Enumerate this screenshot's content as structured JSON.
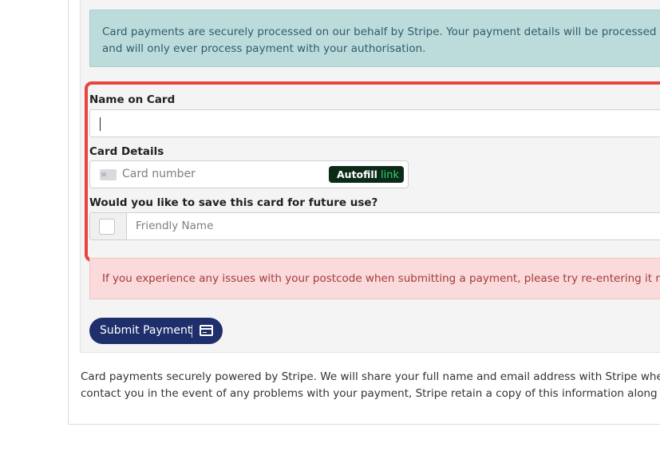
{
  "info_alert": {
    "line1": "Card payments are securely processed on our behalf by Stripe. Your payment details will be processed and stored",
    "line2": "and will only ever process payment with your authorisation."
  },
  "form": {
    "name_label": "Name on Card",
    "name_value": "",
    "card_label": "Card Details",
    "card_placeholder": "Card number",
    "autofill_text": "Autofill",
    "autofill_link_text": "link",
    "save_label": "Would you like to save this card for future use?",
    "friendly_placeholder": "Friendly Name"
  },
  "warning_alert": {
    "text": "If you experience any issues with your postcode when submitting a payment, please try re-entering it manually ar"
  },
  "submit": {
    "label": "Submit Payment"
  },
  "footer": {
    "line1": "Card payments securely powered by Stripe. We will share your full name and email address with Stripe when making p",
    "line2": "contact you in the event of any problems with your payment, Stripe retain a copy of this information along with your p"
  },
  "colors": {
    "highlight": "#e8453f",
    "submit_bg": "#1e2f6b",
    "info_bg": "#bcdcdc",
    "warning_bg": "#fadada",
    "link_green": "#33d36b"
  }
}
